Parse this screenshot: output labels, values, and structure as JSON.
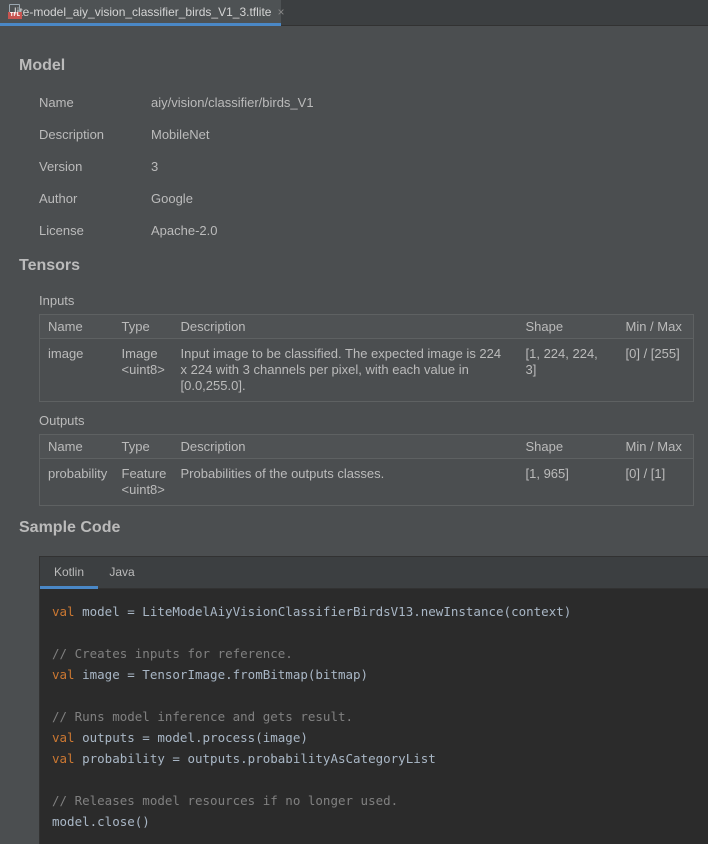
{
  "tab": {
    "badge": "TFL",
    "title": "lite-model_aiy_vision_classifier_birds_V1_3.tflite",
    "close": "×"
  },
  "model": {
    "heading": "Model",
    "rows": [
      {
        "label": "Name",
        "value": "aiy/vision/classifier/birds_V1"
      },
      {
        "label": "Description",
        "value": "MobileNet"
      },
      {
        "label": "Version",
        "value": "3"
      },
      {
        "label": "Author",
        "value": "Google"
      },
      {
        "label": "License",
        "value": "Apache-2.0"
      }
    ]
  },
  "tensors": {
    "heading": "Tensors",
    "columns": [
      "Name",
      "Type",
      "Description",
      "Shape",
      "Min / Max"
    ],
    "inputs": {
      "label": "Inputs",
      "rows": [
        {
          "name": "image",
          "type": "Image <uint8>",
          "description": "Input image to be classified. The expected image is 224 x 224 with 3 channels per pixel, with each value in [0.0,255.0].",
          "shape": "[1, 224, 224, 3]",
          "minmax": "[0] / [255]"
        }
      ]
    },
    "outputs": {
      "label": "Outputs",
      "rows": [
        {
          "name": "probability",
          "type": "Feature <uint8>",
          "description": "Probabilities of the outputs classes.",
          "shape": "[1, 965]",
          "minmax": "[0] / [1]"
        }
      ]
    }
  },
  "sample_code": {
    "heading": "Sample Code",
    "tabs": [
      "Kotlin",
      "Java"
    ],
    "active_tab": "Kotlin",
    "lines": [
      {
        "kw": "val",
        "text": " model = LiteModelAiyVisionClassifierBirdsV13.newInstance(context)"
      },
      {
        "kw": "",
        "text": ""
      },
      {
        "comment": "// Creates inputs for reference."
      },
      {
        "kw": "val",
        "text": " image = TensorImage.fromBitmap(bitmap)"
      },
      {
        "kw": "",
        "text": ""
      },
      {
        "comment": "// Runs model inference and gets result."
      },
      {
        "kw": "val",
        "text": " outputs = model.process(image)"
      },
      {
        "kw": "val",
        "text": " probability = outputs.probabilityAsCategoryList"
      },
      {
        "kw": "",
        "text": ""
      },
      {
        "comment": "// Releases model resources if no longer used."
      },
      {
        "kw": "",
        "text": "model.close()"
      }
    ]
  },
  "colors": {
    "background": "#4b4e50",
    "code_background": "#2b2b2b",
    "keyword": "#cc7832",
    "comment": "#808080",
    "accent": "#4a88c7"
  }
}
